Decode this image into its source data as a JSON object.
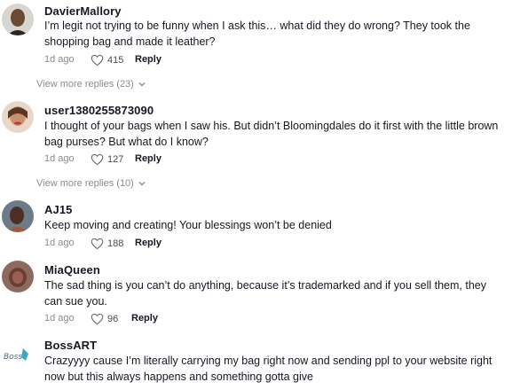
{
  "comments": [
    {
      "username": "DavierMallory",
      "text": "I’m legit not trying to be funny when I ask this… what did they do wrong? They took the shopping bag and made it leather?",
      "time": "1d ago",
      "likes": "415",
      "reply_label": "Reply",
      "view_more": "View more replies (23)"
    },
    {
      "username": "user1380255873090",
      "text": "I thought of your bags when I saw his. But didn’t Bloomingdales do it first with the little brown bag purses? But what do I know?",
      "time": "1d ago",
      "likes": "127",
      "reply_label": "Reply",
      "view_more": "View more replies (10)"
    },
    {
      "username": "AJ15",
      "text": "Keep moving and creating! Your blessings won’t be denied",
      "time": "1d ago",
      "likes": "188",
      "reply_label": "Reply"
    },
    {
      "username": "MiaQueen",
      "text": "The sad thing is you can’t do anything, because it’s trademarked and if you sell them, they can sue you.",
      "time": "1d ago",
      "likes": "96",
      "reply_label": "Reply"
    },
    {
      "username": "BossART",
      "text": "Crazyyyy cause I’m literally carrying my bag right now and sending ppl to your website right now but this always happens and something gotta give",
      "avatar_text": "Boss"
    }
  ],
  "icons": {
    "like": "heart-outline-icon",
    "expand": "chevron-down-icon"
  },
  "colors": {
    "text": "#161823",
    "muted": "#8a8b91"
  }
}
